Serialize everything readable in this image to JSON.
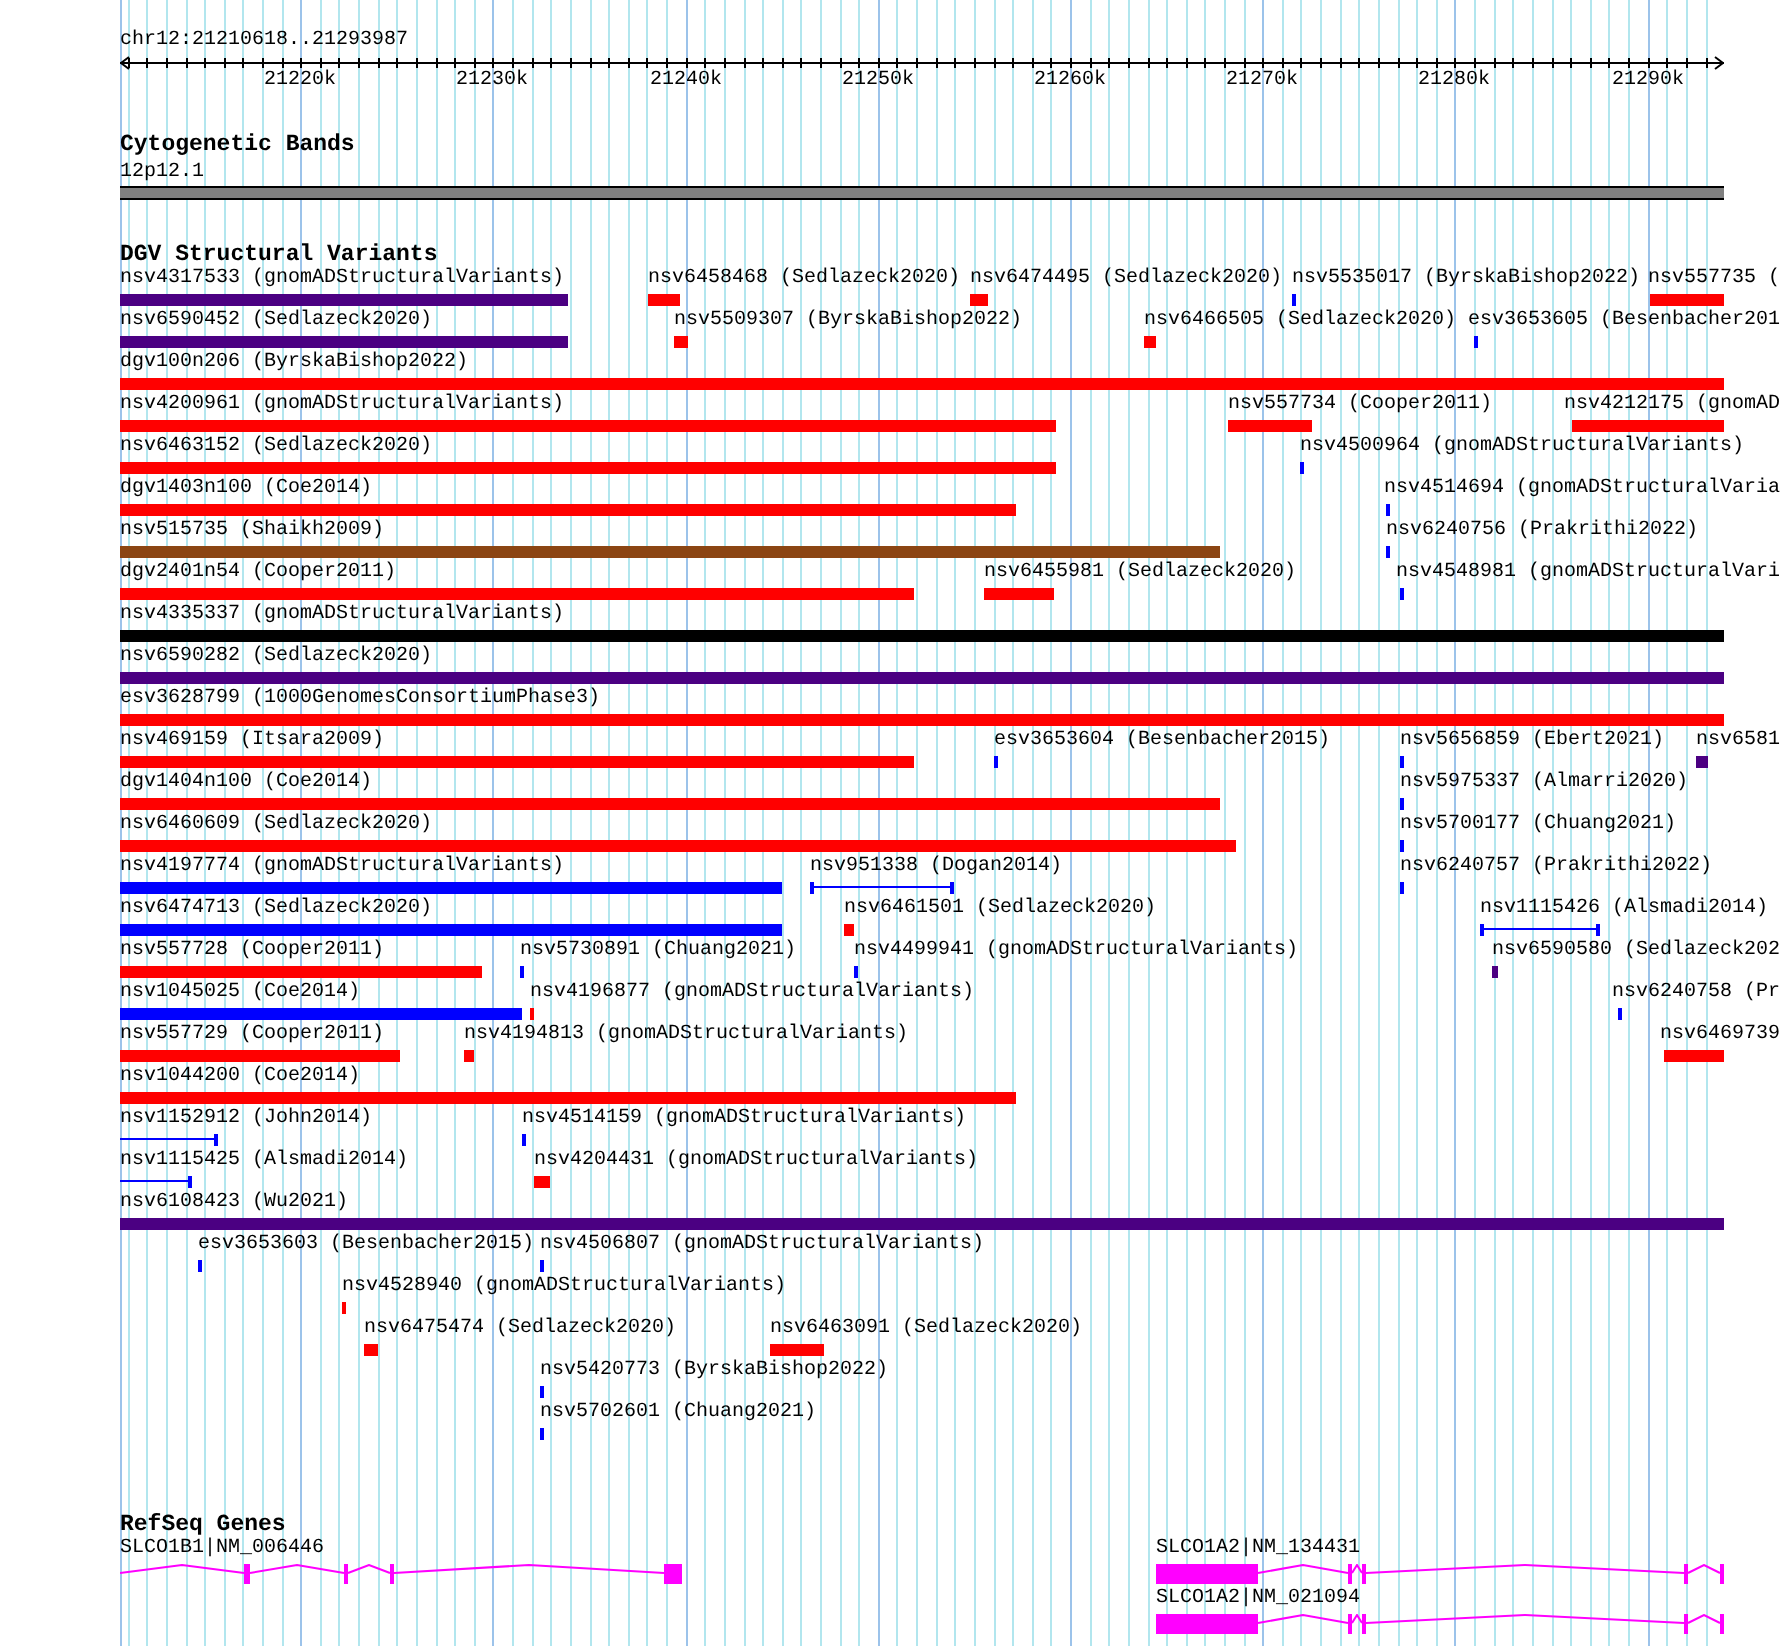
{
  "ruler": {
    "location": "chr12:21210618..21293987",
    "ticks": [
      "21220k",
      "21230k",
      "21240k",
      "21250k",
      "21260k",
      "21270k",
      "21280k",
      "21290k"
    ]
  },
  "cytogenetic_bands": {
    "title": "Cytogenetic Bands",
    "bands": [
      {
        "label": "12p12.1"
      }
    ]
  },
  "dgv_structural_variants": {
    "title": "DGV Structural Variants",
    "rows": [
      [
        {
          "label": "nsv4317533 (gnomADStructuralVariants)",
          "kind": "bar",
          "color": "#4b0082"
        },
        {
          "label": "nsv6458468 (Sedlazeck2020)",
          "kind": "bar",
          "color": "#ff0000"
        },
        {
          "label": "nsv6474495 (Sedlazeck2020)",
          "kind": "bar",
          "color": "#ff0000"
        },
        {
          "label": "nsv5535017 (ByrskaBishop2022)",
          "kind": "bar",
          "color": "#0000ff"
        },
        {
          "label": "nsv557735 (",
          "kind": "bar",
          "color": "#ff0000"
        }
      ],
      [
        {
          "label": "nsv6590452 (Sedlazeck2020)",
          "kind": "bar",
          "color": "#4b0082"
        },
        {
          "label": "nsv5509307 (ByrskaBishop2022)",
          "kind": "bar",
          "color": "#ff0000"
        },
        {
          "label": "nsv6466505 (Sedlazeck2020)",
          "kind": "bar",
          "color": "#ff0000"
        },
        {
          "label": "esv3653605 (Besenbacher201",
          "kind": "bar",
          "color": "#0000ff"
        }
      ],
      [
        {
          "label": "dgv100n206 (ByrskaBishop2022)",
          "kind": "bar",
          "color": "#ff0000"
        }
      ],
      [
        {
          "label": "nsv4200961 (gnomADStructuralVariants)",
          "kind": "bar",
          "color": "#ff0000"
        },
        {
          "label": "nsv557734 (Cooper2011)",
          "kind": "bar",
          "color": "#ff0000"
        },
        {
          "label": "nsv4212175 (gnomAD",
          "kind": "bar",
          "color": "#ff0000"
        }
      ],
      [
        {
          "label": "nsv6463152 (Sedlazeck2020)",
          "kind": "bar",
          "color": "#ff0000"
        },
        {
          "label": "nsv4500964 (gnomADStructuralVariants)",
          "kind": "bar",
          "color": "#0000ff"
        }
      ],
      [
        {
          "label": "dgv1403n100 (Coe2014)",
          "kind": "bar",
          "color": "#ff0000"
        },
        {
          "label": "nsv4514694 (gnomADStructuralVaria",
          "kind": "bar",
          "color": "#0000ff"
        }
      ],
      [
        {
          "label": "nsv515735 (Shaikh2009)",
          "kind": "bar",
          "color": "#8b4513"
        },
        {
          "label": "nsv6240756 (Prakrithi2022)",
          "kind": "bar",
          "color": "#0000ff"
        }
      ],
      [
        {
          "label": "dgv2401n54 (Cooper2011)",
          "kind": "bar",
          "color": "#ff0000"
        },
        {
          "label": "nsv6455981 (Sedlazeck2020)",
          "kind": "bar",
          "color": "#ff0000"
        },
        {
          "label": "nsv4548981 (gnomADStructuralVari",
          "kind": "bar",
          "color": "#0000ff"
        }
      ],
      [
        {
          "label": "nsv4335337 (gnomADStructuralVariants)",
          "kind": "bar",
          "color": "#000000"
        }
      ],
      [
        {
          "label": "nsv6590282 (Sedlazeck2020)",
          "kind": "bar",
          "color": "#4b0082"
        }
      ],
      [
        {
          "label": "esv3628799 (1000GenomesConsortiumPhase3)",
          "kind": "bar",
          "color": "#ff0000"
        }
      ],
      [
        {
          "label": "nsv469159 (Itsara2009)",
          "kind": "bar",
          "color": "#ff0000"
        },
        {
          "label": "esv3653604 (Besenbacher2015)",
          "kind": "bar",
          "color": "#0000ff"
        },
        {
          "label": "nsv5656859 (Ebert2021)",
          "kind": "bar",
          "color": "#0000ff"
        },
        {
          "label": "nsv6581",
          "kind": "bar",
          "color": "#4b0082"
        }
      ],
      [
        {
          "label": "dgv1404n100 (Coe2014)",
          "kind": "bar",
          "color": "#ff0000"
        },
        {
          "label": "nsv5975337 (Almarri2020)",
          "kind": "bar",
          "color": "#0000ff"
        }
      ],
      [
        {
          "label": "nsv6460609 (Sedlazeck2020)",
          "kind": "bar",
          "color": "#ff0000"
        },
        {
          "label": "nsv5700177 (Chuang2021)",
          "kind": "bar",
          "color": "#0000ff"
        }
      ],
      [
        {
          "label": "nsv4197774 (gnomADStructuralVariants)",
          "kind": "bar",
          "color": "#0000ff"
        },
        {
          "label": "nsv951338 (Dogan2014)",
          "kind": "span",
          "color": "#0000ff"
        },
        {
          "label": "nsv6240757 (Prakrithi2022)",
          "kind": "bar",
          "color": "#0000ff"
        }
      ],
      [
        {
          "label": "nsv6474713 (Sedlazeck2020)",
          "kind": "bar",
          "color": "#0000ff"
        },
        {
          "label": "nsv6461501 (Sedlazeck2020)",
          "kind": "bar",
          "color": "#ff0000"
        },
        {
          "label": "nsv1115426 (Alsmadi2014)",
          "kind": "span",
          "color": "#0000ff"
        }
      ],
      [
        {
          "label": "nsv557728 (Cooper2011)",
          "kind": "bar",
          "color": "#ff0000"
        },
        {
          "label": "nsv5730891 (Chuang2021)",
          "kind": "bar",
          "color": "#0000ff"
        },
        {
          "label": "nsv4499941 (gnomADStructuralVariants)",
          "kind": "bar",
          "color": "#0000ff"
        },
        {
          "label": "nsv6590580 (Sedlazeck202",
          "kind": "bar",
          "color": "#4b0082"
        }
      ],
      [
        {
          "label": "nsv1045025 (Coe2014)",
          "kind": "bar",
          "color": "#0000ff"
        },
        {
          "label": "nsv4196877 (gnomADStructuralVariants)",
          "kind": "bar",
          "color": "#ff0000"
        },
        {
          "label": "nsv6240758 (Pr",
          "kind": "bar",
          "color": "#0000ff"
        }
      ],
      [
        {
          "label": "nsv557729 (Cooper2011)",
          "kind": "bar",
          "color": "#ff0000"
        },
        {
          "label": "nsv4194813 (gnomADStructuralVariants)",
          "kind": "bar",
          "color": "#ff0000"
        },
        {
          "label": "nsv6469739",
          "kind": "bar",
          "color": "#ff0000"
        }
      ],
      [
        {
          "label": "nsv1044200 (Coe2014)",
          "kind": "bar",
          "color": "#ff0000"
        }
      ],
      [
        {
          "label": "nsv1152912 (John2014)",
          "kind": "span",
          "color": "#0000ff"
        },
        {
          "label": "nsv4514159 (gnomADStructuralVariants)",
          "kind": "bar",
          "color": "#0000ff"
        }
      ],
      [
        {
          "label": "nsv1115425 (Alsmadi2014)",
          "kind": "span",
          "color": "#0000ff"
        },
        {
          "label": "nsv4204431 (gnomADStructuralVariants)",
          "kind": "bar",
          "color": "#ff0000"
        }
      ],
      [
        {
          "label": "nsv6108423 (Wu2021)",
          "kind": "bar",
          "color": "#4b0082"
        }
      ],
      [
        {
          "label": "esv3653603 (Besenbacher2015)",
          "kind": "bar",
          "color": "#0000ff"
        },
        {
          "label": "nsv4506807 (gnomADStructuralVariants)",
          "kind": "bar",
          "color": "#0000ff"
        }
      ],
      [
        {
          "label": "nsv4528940 (gnomADStructuralVariants)",
          "kind": "bar",
          "color": "#ff0000"
        }
      ],
      [
        {
          "label": "nsv6475474 (Sedlazeck2020)",
          "kind": "bar",
          "color": "#ff0000"
        },
        {
          "label": "nsv6463091 (Sedlazeck2020)",
          "kind": "bar",
          "color": "#ff0000"
        }
      ],
      [
        {
          "label": "nsv5420773 (ByrskaBishop2022)",
          "kind": "bar",
          "color": "#0000ff"
        }
      ],
      [
        {
          "label": "nsv5702601 (Chuang2021)",
          "kind": "bar",
          "color": "#0000ff"
        }
      ]
    ]
  },
  "refseq_genes": {
    "title": "RefSeq Genes",
    "genes": [
      {
        "label": "SLCO1B1|NM_006446"
      },
      {
        "label": "SLCO1A2|NM_134431"
      },
      {
        "label": "SLCO1A2|NM_021094"
      }
    ]
  }
}
